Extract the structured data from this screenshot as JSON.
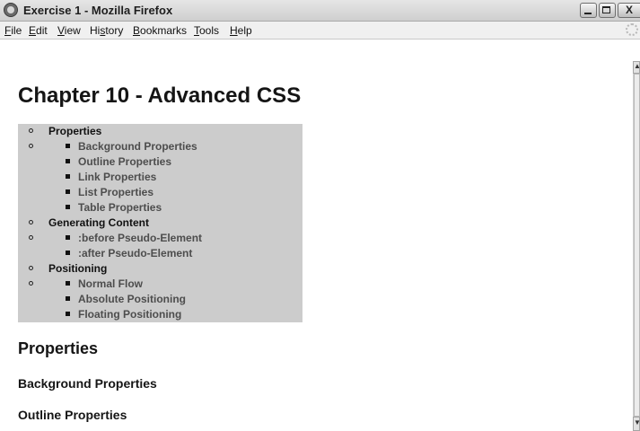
{
  "window": {
    "title": "Exercise 1 - Mozilla Firefox",
    "minimize": "_",
    "maximize": "□",
    "close": "X"
  },
  "menu": [
    {
      "pre": "",
      "u": "F",
      "post": "ile"
    },
    {
      "pre": "",
      "u": "E",
      "post": "dit"
    },
    {
      "pre": "",
      "u": "V",
      "post": "iew"
    },
    {
      "pre": "Hi",
      "u": "s",
      "post": "tory"
    },
    {
      "pre": "",
      "u": "B",
      "post": "ookmarks"
    },
    {
      "pre": "",
      "u": "T",
      "post": "ools"
    },
    {
      "pre": "",
      "u": "H",
      "post": "elp"
    }
  ],
  "page": {
    "title": "Chapter 10 - Advanced CSS",
    "toc": [
      {
        "label": "Properties",
        "children": [
          "Background Properties",
          "Outline Properties",
          "Link Properties",
          "List Properties",
          "Table Properties"
        ]
      },
      {
        "label": "Generating Content",
        "children": [
          ":before Pseudo-Element",
          ":after Pseudo-Element"
        ]
      },
      {
        "label": "Positioning",
        "children": [
          "Normal Flow",
          "Absolute Positioning",
          "Floating Positioning"
        ]
      }
    ],
    "section_heading": "Properties",
    "sub_headings": [
      "Background Properties",
      "Outline Properties"
    ]
  }
}
